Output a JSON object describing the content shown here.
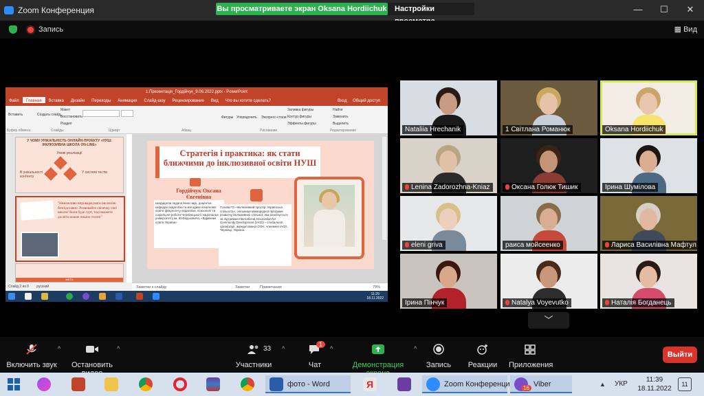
{
  "window": {
    "app_title": "Zoom Конференция",
    "share_banner": "Вы просматриваете экран Oksana Hordiichuk",
    "view_options": "Настройки просмотра",
    "minimize": "—",
    "maximize": "☐",
    "close": "✕"
  },
  "meeting_bar": {
    "recording_label": "Запись",
    "view_toggle": "Вид"
  },
  "shared_screen": {
    "ppt_title": "1.Презентація_Гордійчук_9.06.2022.pptx - PowerPoint",
    "ppt_tabs": [
      "Файл",
      "Главная",
      "Вставка",
      "Дизайн",
      "Переходы",
      "Анимация",
      "Слайд-шоу",
      "Рецензирование",
      "Вид",
      "Что вы хотите сделать?",
      "Вход",
      "Общий доступ"
    ],
    "ribbon_groups": [
      "Буфер обмена",
      "Слайды",
      "Шрифт",
      "Абзац",
      "Рисование",
      "Редактирование"
    ],
    "ribbon_buttons": [
      "Вставить",
      "Создать слайд",
      "Макет",
      "Восстановить",
      "Раздел",
      "Фигуры",
      "Упорядочить",
      "Экспресс-стили",
      "Заливка фигуры",
      "Контур фигуры",
      "Эффекты фигуры",
      "Найти",
      "Заменить",
      "Выделить"
    ],
    "thumb1_title": "У ЧОМУ УНІКАЛЬНІСТЬ ОНЛАЙН-ПРОЕКТУ «НУШ: ІНКЛЮЗИВНА ШКОЛА ON-LINE»",
    "thumb1_sub": "Умові реалізації",
    "thumb1_left": "В унікальності контенту",
    "thumb1_right": "У системі тестів",
    "thumb2_text": "\"Неможливо впроваджувати інклюзію безпідставно. Розвивайте свічечку свої школи! Коли буде гурт, тоді вкажете досвіти кожне пишно тисячі\"",
    "thumb3_label": "МЕТА",
    "slide_heading": "Стратегія і практика: як стати ближчими до інклюзивної освіти НУШ",
    "slide_name": "Гордійчук Оксана Євгенівна",
    "slide_bio1": "кандидатка педагогічних наук, доцентка кафедри педагогіки та методики початкової освіти факультету педагогіки, психології та соціальної роботи Чернівецького національного університету ім. Ю.Федьковича, «Відмінник освіти України»",
    "slide_bio2": "Голова ГО «Інклюзивний простір. Українська спільнота», очільниця міжнародної програми розвитку інклюзивних спільнот, яка реалізується за підтримки International Association for Community Development (IACD) – глобальної організації, акредитованої ООН, членкиня IACD, Чернівці, Україна.",
    "notes_placeholder": "Заметки к слайду",
    "status_slide": "Слайд 2 из 9",
    "status_lang": "русский",
    "status_notes": "Заметки",
    "status_comments": "Примечания",
    "status_zoom": "79%",
    "inner_time": "11:29",
    "inner_date": "18.11.2022"
  },
  "participants": [
    {
      "name": "Nataliia Hrechanik",
      "muted": false,
      "bg": "#d7dde2",
      "face": "#c99a82",
      "hair": "#2a1a16",
      "shirt": "#1a1a1a"
    },
    {
      "name": "1 Світлана Романюк",
      "muted": false,
      "bg": "#6b5a3e",
      "face": "#e6c3a6",
      "hair": "#c9a860",
      "shirt": "#c8cfd8"
    },
    {
      "name": "Oksana Hordiichuk",
      "muted": false,
      "bg": "#f3ece4",
      "face": "#e9c7ad",
      "hair": "#c9a56a",
      "shirt": "#f6e56a",
      "active": true
    },
    {
      "name": "Lenina Zadorozhna-Kniaz",
      "muted": true,
      "bg": "#d9d2c9",
      "face": "#e1c1a6",
      "hair": "#b7a585",
      "shirt": "#2b2b2b"
    },
    {
      "name": "Оксана Голюк Тишик",
      "muted": true,
      "bg": "#1e1e1e",
      "face": "#c49478",
      "hair": "#3b2316",
      "shirt": "#8a3b34"
    },
    {
      "name": "Ірина Шумілова",
      "muted": false,
      "bg": "#dfe2e4",
      "face": "#d9ad90",
      "hair": "#1e1410",
      "shirt": "#4d6a84"
    },
    {
      "name": "eleni griva",
      "muted": true,
      "bg": "#e6e8ea",
      "face": "#ecd0bc",
      "hair": "#d8c08a",
      "shirt": "#7a8a9a"
    },
    {
      "name": "раиса мойсеенко",
      "muted": false,
      "bg": "#cfd3d6",
      "face": "#d8ae92",
      "hair": "#8a6b4a",
      "shirt": "#c44a3a"
    },
    {
      "name": "Лариса Василівна Мафтул",
      "muted": true,
      "bg": "#7a6a3a",
      "face": "#e1b9a0",
      "hair": "#d6cfc6",
      "shirt": "#3d4a5a"
    },
    {
      "name": "Ірина Пінчук",
      "muted": false,
      "bg": "#c9c4be",
      "face": "#d9a88c",
      "hair": "#3a1810",
      "shirt": "#b2222a"
    },
    {
      "name": "Natalya Voyevutko",
      "muted": true,
      "bg": "#ececec",
      "face": "#c9987c",
      "hair": "#4a2a1a",
      "shirt": "#2d2d2d"
    },
    {
      "name": "Наталія Богданець",
      "muted": true,
      "bg": "#e7e4e2",
      "face": "#e4bca4",
      "hair": "#2a1a14",
      "shirt": "#d64a6a"
    }
  ],
  "controls": {
    "audio": "Включить звук",
    "video": "Остановить видео",
    "participants": "Участники",
    "participants_count": "33",
    "chat": "Чат",
    "chat_badge": "1",
    "share": "Демонстрация экрана",
    "record": "Запись",
    "reactions": "Реакции",
    "apps": "Приложения",
    "leave": "Выйти"
  },
  "taskbar": {
    "word_label": "фото - Word",
    "zoom_label": "Zoom Конференция",
    "viber_label": "Viber",
    "viber_badge": "16",
    "lang": "УКР",
    "time": "11:39",
    "date": "18.11.2022",
    "notif_count": "11",
    "tray_arrow": "▲"
  },
  "colors": {
    "share_green": "#2bb24c",
    "leave_red": "#d9342b",
    "ppt_orange": "#c0432a",
    "active_speaker": "#d9e84a"
  }
}
